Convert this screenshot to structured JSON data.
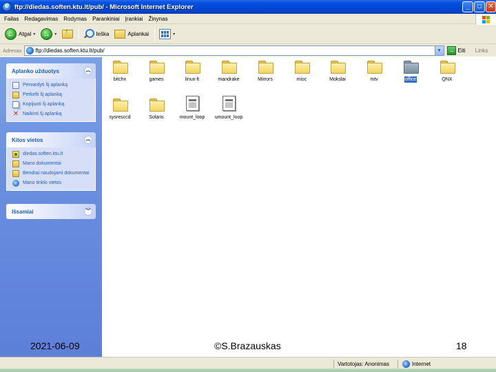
{
  "window": {
    "title": "ftp://diedas.soften.ktu.lt/pub/ - Microsoft Internet Explorer",
    "minimize_glyph": "_",
    "maximize_glyph": "□",
    "close_glyph": "✕"
  },
  "menu": [
    "Failas",
    "Redagavimas",
    "Rodymas",
    "Parankiniai",
    "Įrankiai",
    "Žinynas"
  ],
  "toolbar": {
    "back_label": "Atgal",
    "back_glyph": "←",
    "forward_glyph": "→",
    "dropdown_glyph": "▾",
    "search_label": "Ieška",
    "folders_label": "Aplankai"
  },
  "address": {
    "label": "Adresas",
    "value": "ftp://diedas.soften.ktu.lt/pub/",
    "dropdown_glyph": "▾",
    "go_label": "Eiti",
    "go_glyph": "→",
    "links_label": "Links"
  },
  "taskpane": {
    "collapse_up_glyph": "︽",
    "collapse_down_glyph": "︾",
    "panels": [
      {
        "title": "Aplanko užduotys",
        "tasks": [
          {
            "label": "Pervardyti šį aplanką",
            "icon": "rename-icon"
          },
          {
            "label": "Perkelti šį aplanką",
            "icon": "move-folder-icon"
          },
          {
            "label": "Kopijuoti šį aplanką",
            "icon": "copy-folder-icon"
          },
          {
            "label": "Naikinti šį aplanką",
            "icon": "delete-icon"
          }
        ]
      },
      {
        "title": "Kitos vietos",
        "tasks": [
          {
            "label": "diedas.soften.ktu.lt",
            "icon": "ftp-site-icon"
          },
          {
            "label": "Mano dokumentai",
            "icon": "my-documents-icon"
          },
          {
            "label": "Bendrai naudojami dokumentai",
            "icon": "shared-documents-icon"
          },
          {
            "label": "Mano tinklo vietos",
            "icon": "network-places-icon"
          }
        ]
      },
      {
        "title": "Išsamiai",
        "tasks": []
      }
    ]
  },
  "files": [
    {
      "name": "bitchx",
      "type": "folder",
      "selected": false
    },
    {
      "name": "games",
      "type": "folder",
      "selected": false
    },
    {
      "name": "linux-lt",
      "type": "folder",
      "selected": false
    },
    {
      "name": "mandrake",
      "type": "folder",
      "selected": false
    },
    {
      "name": "Mirrors",
      "type": "folder",
      "selected": false
    },
    {
      "name": "misc",
      "type": "folder",
      "selected": false
    },
    {
      "name": "Mokslai",
      "type": "folder",
      "selected": false
    },
    {
      "name": "mtv",
      "type": "folder",
      "selected": false
    },
    {
      "name": "office",
      "type": "folder",
      "selected": true
    },
    {
      "name": "QNX",
      "type": "folder",
      "selected": false
    },
    {
      "name": "sysresccd",
      "type": "folder",
      "selected": false
    },
    {
      "name": "Solaris",
      "type": "folder",
      "selected": false
    },
    {
      "name": "mount_loop",
      "type": "file",
      "selected": false
    },
    {
      "name": "umount_loop",
      "type": "file",
      "selected": false
    }
  ],
  "footer": {
    "date": "2021-06-09",
    "author": "©S.Brazauskas",
    "page": "18"
  },
  "status": {
    "user": "Vartotojas: Anonimas",
    "zone": "Internet"
  }
}
